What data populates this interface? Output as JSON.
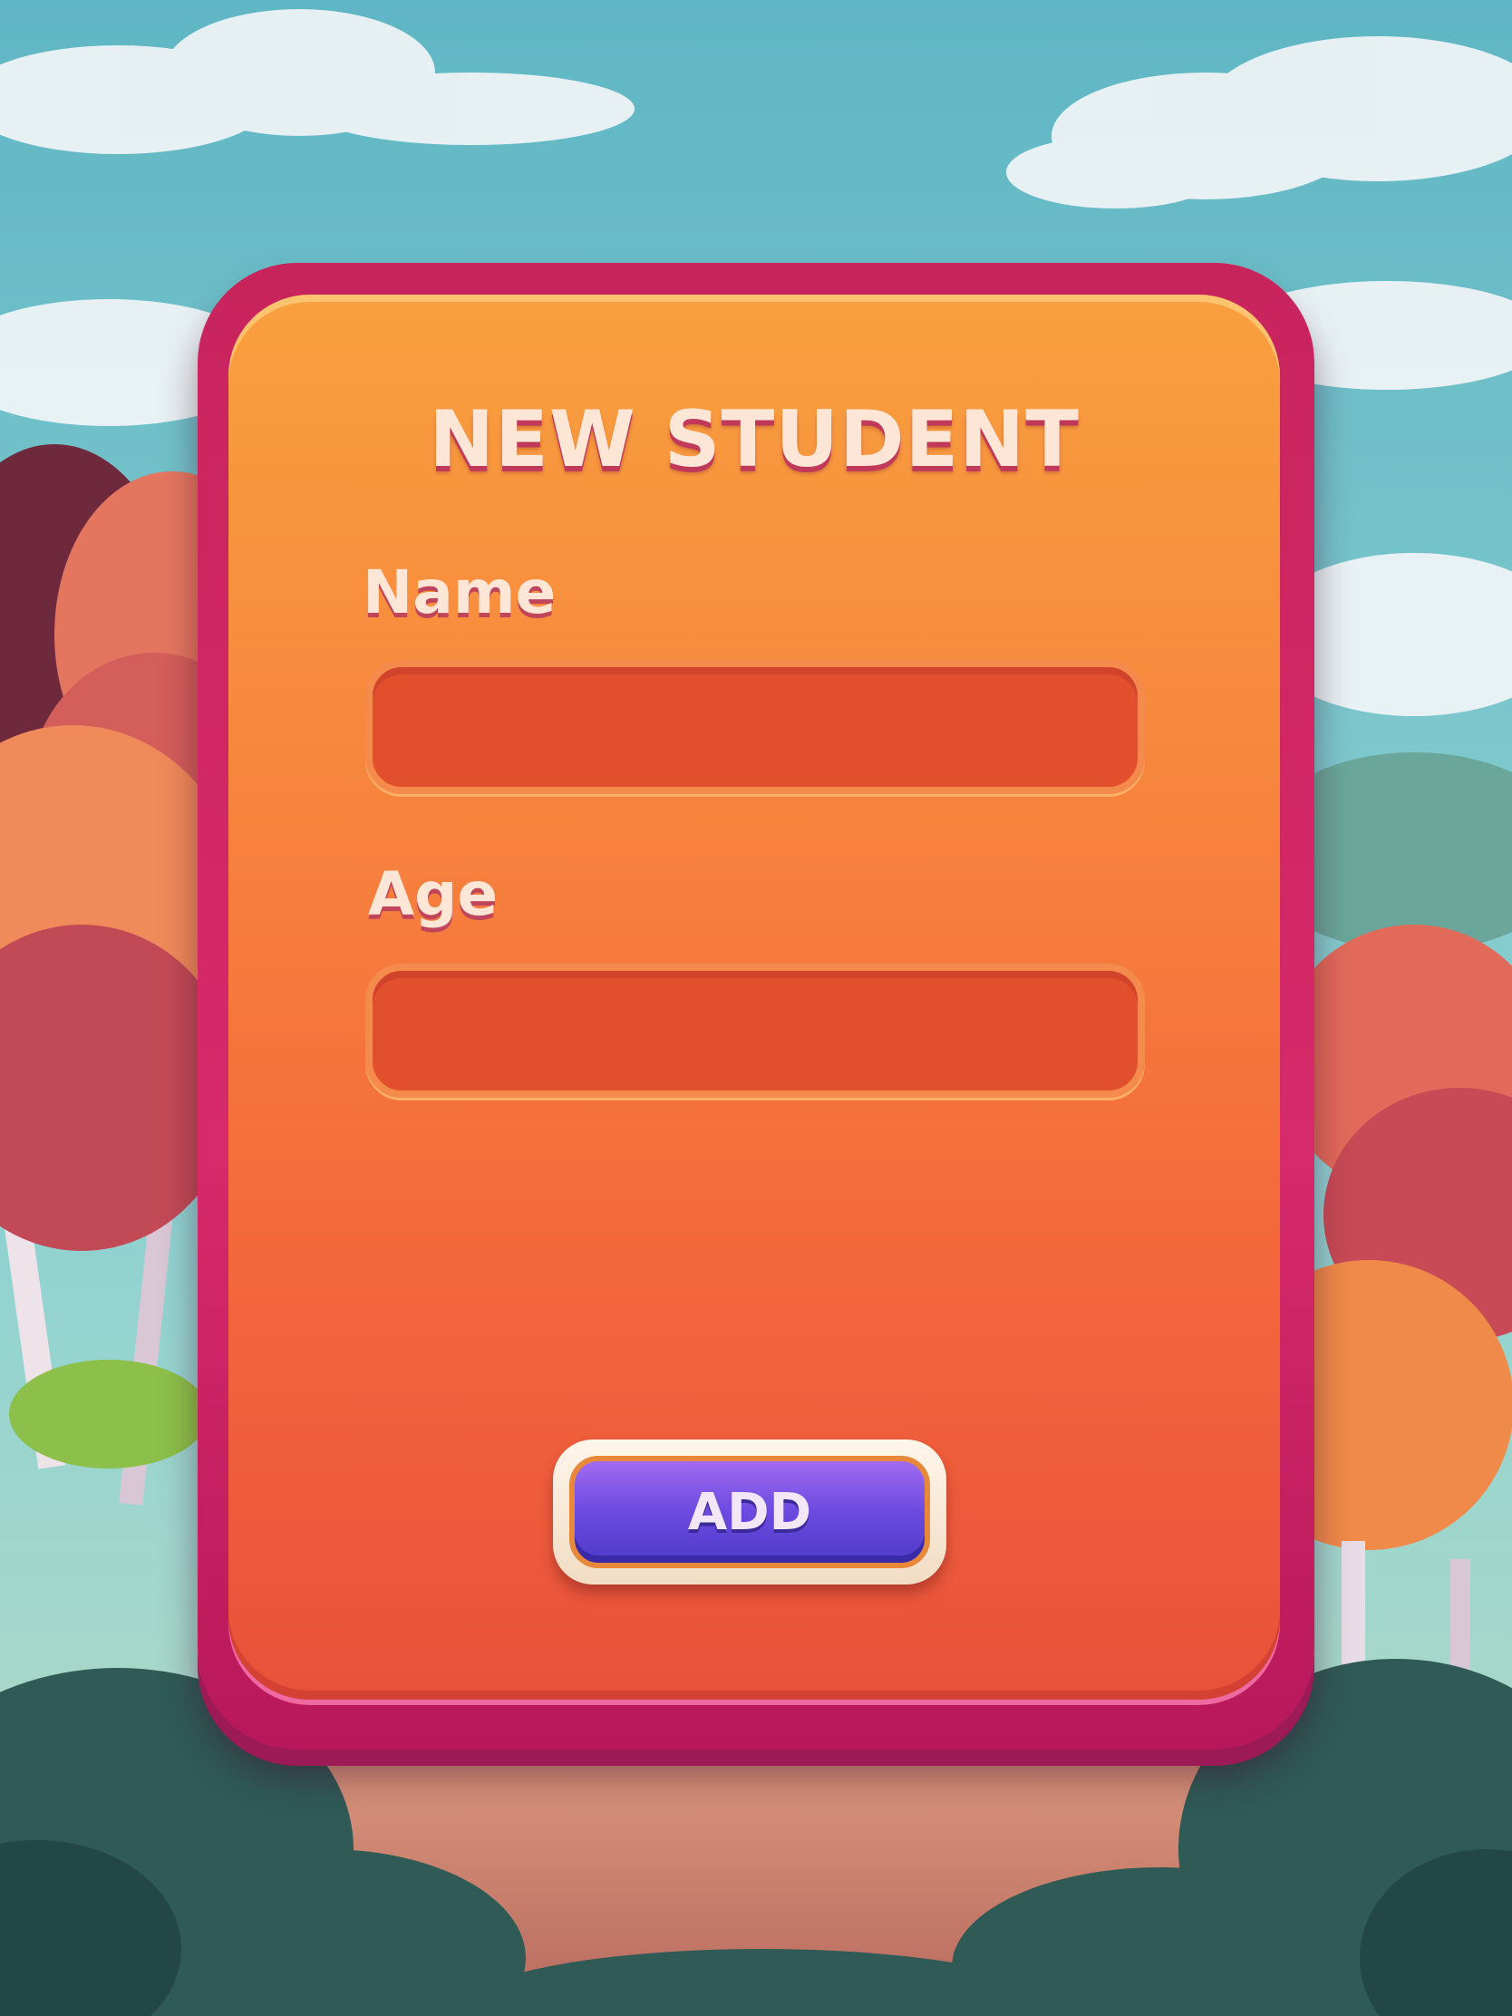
{
  "form": {
    "title": "NEW STUDENT",
    "name_label": "Name",
    "name_value": "",
    "age_label": "Age",
    "age_value": "",
    "add_label": "ADD"
  },
  "colors": {
    "sky": "#7cc8cf",
    "frame": "#cd2763",
    "panel_top": "#f9a03f",
    "panel_bottom": "#e8523a",
    "field": "#e24f2c",
    "button": "#6b4ae0",
    "label_text": "#fde6d6"
  }
}
